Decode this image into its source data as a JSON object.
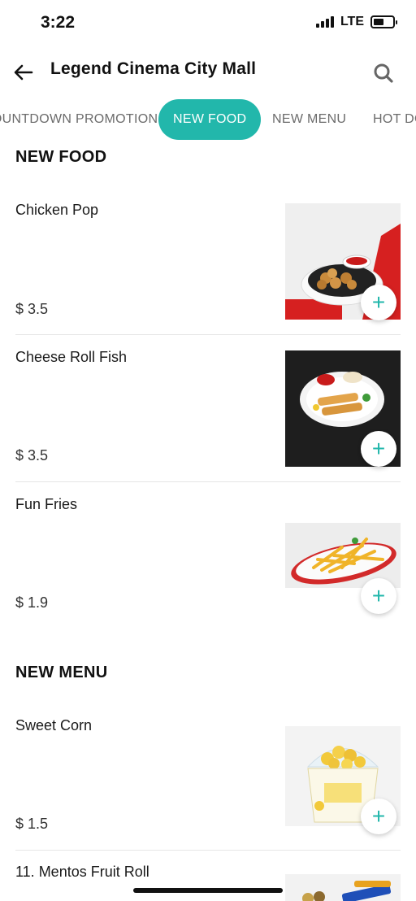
{
  "status": {
    "time": "3:22",
    "network": "LTE"
  },
  "header": {
    "title": "Legend Cinema City Mall"
  },
  "tabs": [
    {
      "label": "COUNTDOWN PROMOTION"
    },
    {
      "label": "NEW FOOD"
    },
    {
      "label": "NEW MENU"
    },
    {
      "label": "HOT DOG"
    }
  ],
  "active_tab": "NEW FOOD",
  "sections": [
    {
      "title": "NEW FOOD",
      "items": [
        {
          "name": "Chicken Pop",
          "price": "$ 3.5"
        },
        {
          "name": "Cheese Roll Fish",
          "price": "$ 3.5"
        },
        {
          "name": "Fun Fries",
          "price": "$ 1.9"
        }
      ]
    },
    {
      "title": "NEW MENU",
      "items": [
        {
          "name": "Sweet Corn",
          "price": "$ 1.5"
        },
        {
          "name": "11. Mentos Fruit Roll",
          "price": ""
        }
      ]
    }
  ],
  "colors": {
    "accent": "#22b7ab",
    "text": "#1a1a1a",
    "divider": "#e6e6e6"
  }
}
